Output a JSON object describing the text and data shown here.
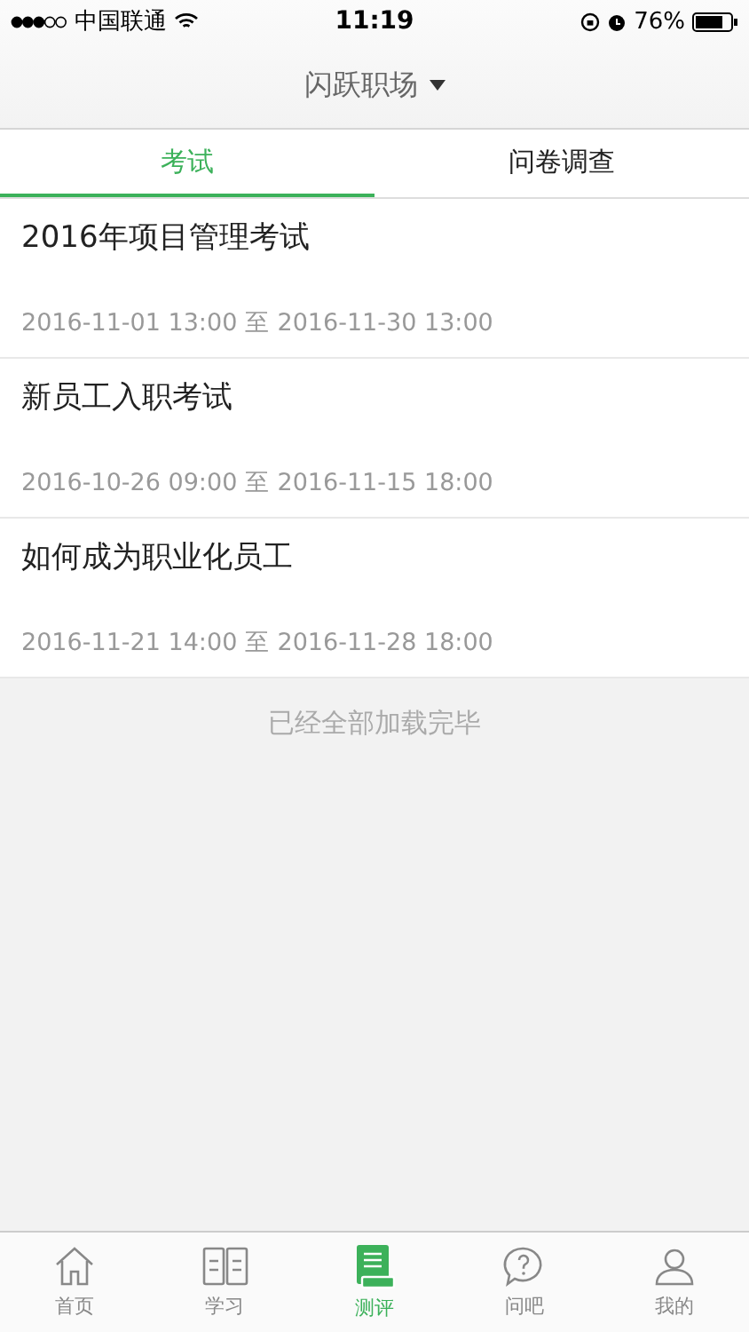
{
  "status_bar": {
    "carrier": "中国联通",
    "time": "11:19",
    "battery": "76%"
  },
  "nav": {
    "title": "闪跃职场"
  },
  "tabs": [
    {
      "label": "考试",
      "selected": true
    },
    {
      "label": "问卷调查",
      "selected": false
    }
  ],
  "exams": [
    {
      "title": "2016年项目管理考试",
      "period": "2016-11-01 13:00 至 2016-11-30 13:00"
    },
    {
      "title": "新员工入职考试",
      "period": "2016-10-26 09:00 至 2016-11-15 18:00"
    },
    {
      "title": "如何成为职业化员工",
      "period": "2016-11-21 14:00 至 2016-11-28 18:00"
    }
  ],
  "footer_note": "已经全部加载完毕",
  "tab_bar": [
    {
      "label": "首页",
      "selected": false
    },
    {
      "label": "学习",
      "selected": false
    },
    {
      "label": "测评",
      "selected": true
    },
    {
      "label": "问吧",
      "selected": false
    },
    {
      "label": "我的",
      "selected": false
    }
  ]
}
